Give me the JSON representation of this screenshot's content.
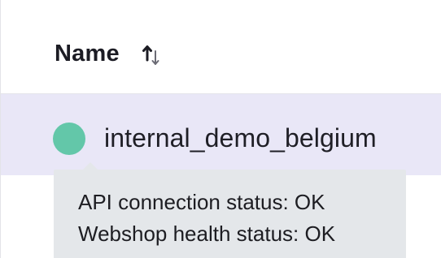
{
  "table": {
    "header": {
      "name_label": "Name",
      "sort_icon": "sort-arrows-icon"
    },
    "rows": [
      {
        "name": "internal_demo_belgium",
        "status_color": "#63c7a9",
        "status_icon": "status-dot-icon"
      }
    ]
  },
  "tooltip": {
    "lines": [
      "API connection status: OK",
      "Webshop health status: OK"
    ]
  },
  "colors": {
    "row_hover_bg": "#e9e7f7",
    "tooltip_bg": "#e4e7ea",
    "status_ok": "#63c7a9"
  }
}
